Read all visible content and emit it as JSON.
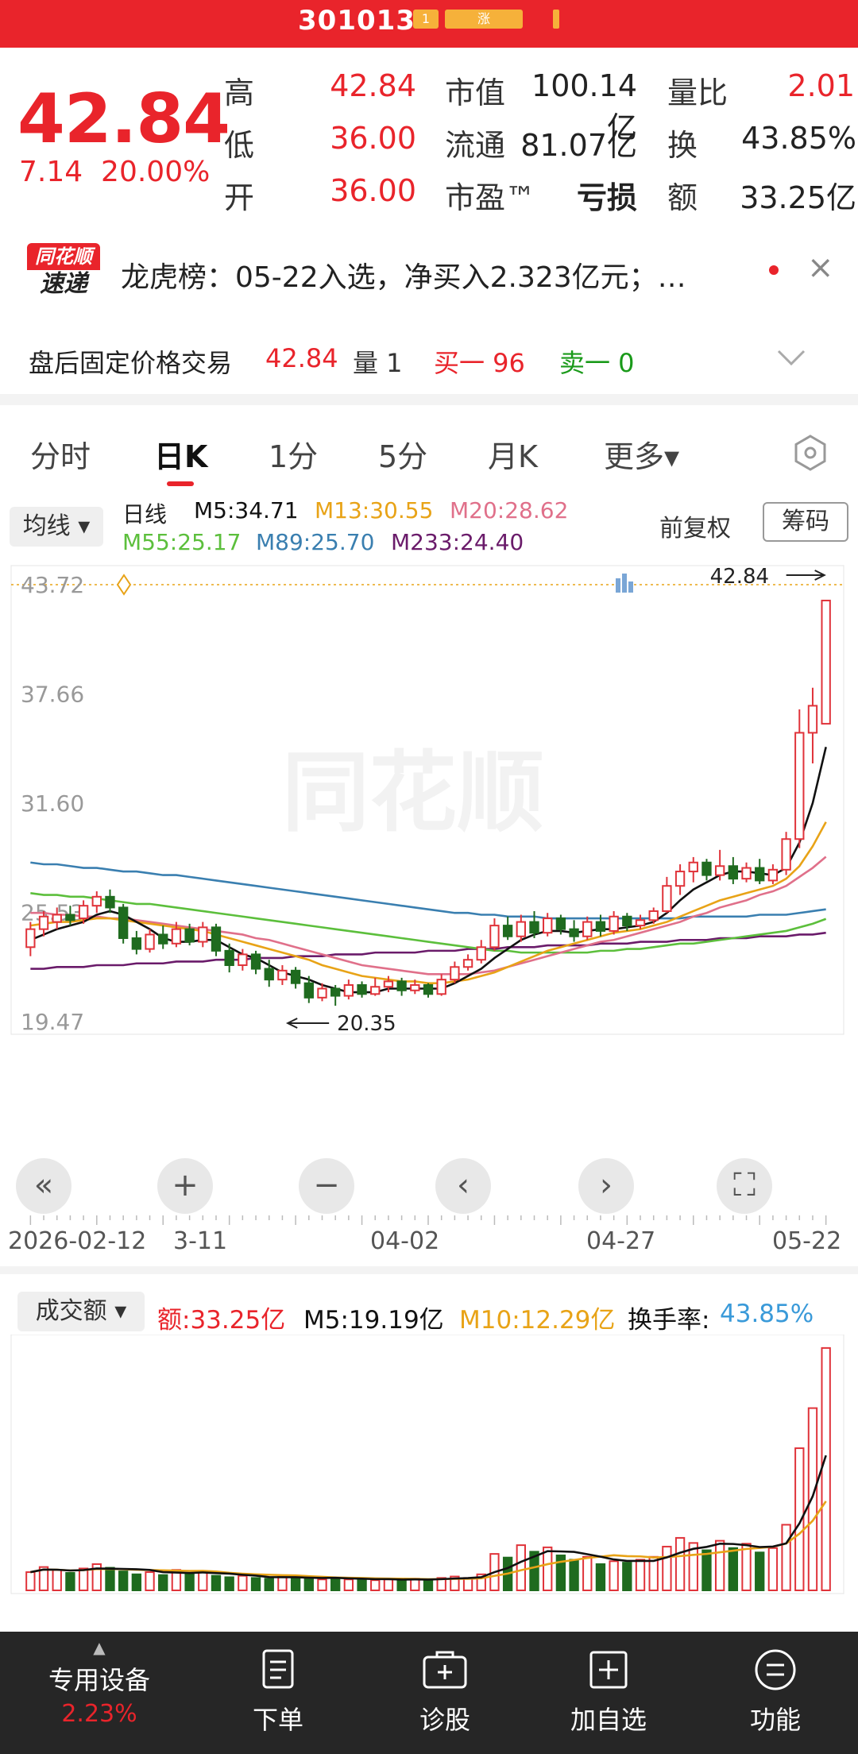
{
  "header": {
    "code": "301013",
    "tag1": "1",
    "tag2": "涨"
  },
  "quote": {
    "price": "42.84",
    "change": "7.14",
    "change_pct": "20.00%",
    "rows": [
      {
        "l1": "高",
        "v1": "42.84",
        "l2": "市值",
        "v2": "100.14亿",
        "l3": "量比",
        "v3": "2.01"
      },
      {
        "l1": "低",
        "v1": "36.00",
        "l2": "流通",
        "v2": "81.07亿",
        "l3": "换",
        "v3": "43.85%"
      },
      {
        "l1": "开",
        "v1": "36.00",
        "l2": "市盈™",
        "v2": "亏损",
        "l3": "额",
        "v3": "33.25亿"
      }
    ]
  },
  "news": {
    "logo_top": "同花顺",
    "logo_bottom": "速递",
    "text": "龙虎榜：05-22入选，净买入2.323亿元；…",
    "close": "×"
  },
  "fixed_trade": {
    "label": "盘后固定价格交易",
    "price": "42.84",
    "vol_label": "量 1",
    "buy": "买一 96",
    "sell": "卖一 0"
  },
  "tabs": [
    "分时",
    "日K",
    "1分",
    "5分",
    "月K",
    "更多▾"
  ],
  "kline_legend": {
    "ma_button": "均线 ▾",
    "daily": "日线",
    "m5": "M5:34.71",
    "m13": "M13:30.55",
    "m20": "M20:28.62",
    "m55": "M55:25.17",
    "m89": "M89:25.70",
    "m233": "M233:24.40",
    "fq": "前复权",
    "chips": "筹码",
    "colors": {
      "m5": "#111111",
      "m13": "#e8a317",
      "m20": "#e0708a",
      "m55": "#5cbf3c",
      "m89": "#3a7fb0",
      "m233": "#6a1b6a"
    }
  },
  "kline_axis": {
    "y_labels": [
      "43.72",
      "37.66",
      "31.60",
      "25.53",
      "19.47"
    ],
    "x_labels": [
      "2026-02-12",
      "3-11",
      "04-02",
      "04-27",
      "05-22"
    ],
    "high_mark": "42.84",
    "low_mark": "20.35"
  },
  "volume_legend": {
    "button": "成交额 ▾",
    "amount": "额:33.25亿",
    "m5": "M5:19.19亿",
    "m10": "M10:12.29亿",
    "turnover_label": "换手率:",
    "turnover": "43.85%"
  },
  "bottom_nav": [
    {
      "label": "专用设备",
      "sub": "2.23%",
      "icon": "▲"
    },
    {
      "label": "下单",
      "icon": "order-icon"
    },
    {
      "label": "诊股",
      "icon": "diagnose-icon"
    },
    {
      "label": "加自选",
      "icon": "add-favorite-icon"
    },
    {
      "label": "功能",
      "icon": "menu-icon"
    }
  ],
  "chart_data": {
    "type": "candlestick",
    "ylim": [
      19.47,
      43.72
    ],
    "candles": [
      [
        23.6,
        24.6,
        23.1,
        25.0
      ],
      [
        24.6,
        25.3,
        24.2,
        25.6
      ],
      [
        25.0,
        25.4,
        24.6,
        25.8
      ],
      [
        25.4,
        25.1,
        24.8,
        25.9
      ],
      [
        25.2,
        25.9,
        24.9,
        26.2
      ],
      [
        25.9,
        26.4,
        25.5,
        26.7
      ],
      [
        26.4,
        25.8,
        25.5,
        26.8
      ],
      [
        25.8,
        24.1,
        23.8,
        26.0
      ],
      [
        24.1,
        23.5,
        23.2,
        24.5
      ],
      [
        23.5,
        24.3,
        23.3,
        24.6
      ],
      [
        24.3,
        23.8,
        23.5,
        24.8
      ],
      [
        23.8,
        24.6,
        23.6,
        25.0
      ],
      [
        24.6,
        23.9,
        23.7,
        24.9
      ],
      [
        23.9,
        24.7,
        23.6,
        25.0
      ],
      [
        24.7,
        23.4,
        23.1,
        24.9
      ],
      [
        23.4,
        22.6,
        22.2,
        23.8
      ],
      [
        22.6,
        23.2,
        22.3,
        23.5
      ],
      [
        23.2,
        22.4,
        22.1,
        23.4
      ],
      [
        22.4,
        21.8,
        21.4,
        22.9
      ],
      [
        21.8,
        22.3,
        21.5,
        22.6
      ],
      [
        22.3,
        21.6,
        21.3,
        22.5
      ],
      [
        21.6,
        20.8,
        20.5,
        22.0
      ],
      [
        20.8,
        21.3,
        20.6,
        21.6
      ],
      [
        21.3,
        20.9,
        20.35,
        21.5
      ],
      [
        20.9,
        21.5,
        20.7,
        21.8
      ],
      [
        21.5,
        21.0,
        20.8,
        21.7
      ],
      [
        21.0,
        21.4,
        20.9,
        21.9
      ],
      [
        21.4,
        21.7,
        21.1,
        22.0
      ],
      [
        21.7,
        21.2,
        20.9,
        21.9
      ],
      [
        21.2,
        21.5,
        21.0,
        21.8
      ],
      [
        21.5,
        21.0,
        20.8,
        21.6
      ],
      [
        21.0,
        21.8,
        20.9,
        22.1
      ],
      [
        21.8,
        22.5,
        21.6,
        22.8
      ],
      [
        22.5,
        22.9,
        22.3,
        23.2
      ],
      [
        22.9,
        23.6,
        22.7,
        24.0
      ],
      [
        23.6,
        24.8,
        23.4,
        25.2
      ],
      [
        24.8,
        24.2,
        24.0,
        25.3
      ],
      [
        24.2,
        25.0,
        23.9,
        25.4
      ],
      [
        25.0,
        24.4,
        24.1,
        25.6
      ],
      [
        24.4,
        25.2,
        24.2,
        25.5
      ],
      [
        25.2,
        24.6,
        24.3,
        25.4
      ],
      [
        24.6,
        24.2,
        23.9,
        25.1
      ],
      [
        24.2,
        25.0,
        24.0,
        25.3
      ],
      [
        25.0,
        24.5,
        24.2,
        25.4
      ],
      [
        24.5,
        25.3,
        24.3,
        25.6
      ],
      [
        25.3,
        24.8,
        24.5,
        25.5
      ],
      [
        24.8,
        25.1,
        24.6,
        25.4
      ],
      [
        25.1,
        25.6,
        24.9,
        25.8
      ],
      [
        25.6,
        27.0,
        25.5,
        27.5
      ],
      [
        27.0,
        27.8,
        26.5,
        28.2
      ],
      [
        27.8,
        28.3,
        27.2,
        28.6
      ],
      [
        28.3,
        27.6,
        27.3,
        28.5
      ],
      [
        27.6,
        28.1,
        27.3,
        29.0
      ],
      [
        28.1,
        27.4,
        27.1,
        28.6
      ],
      [
        27.4,
        28.0,
        27.2,
        28.3
      ],
      [
        28.0,
        27.3,
        27.1,
        28.5
      ],
      [
        27.3,
        27.9,
        27.1,
        28.2
      ],
      [
        27.9,
        29.6,
        27.6,
        30.0
      ],
      [
        29.6,
        35.5,
        29.1,
        36.8
      ],
      [
        35.5,
        37.0,
        33.8,
        38.0
      ],
      [
        36.0,
        42.84,
        36.0,
        42.84
      ]
    ],
    "ma5": [
      24.0,
      24.3,
      24.6,
      24.8,
      25.0,
      25.4,
      25.6,
      25.4,
      25.0,
      24.6,
      24.1,
      23.9,
      23.9,
      24.0,
      24.0,
      23.6,
      23.2,
      23.0,
      22.6,
      22.2,
      22.0,
      21.8,
      21.5,
      21.3,
      21.1,
      21.1,
      21.1,
      21.3,
      21.3,
      21.3,
      21.3,
      21.3,
      21.6,
      22.0,
      22.4,
      23.0,
      23.5,
      24.0,
      24.3,
      24.5,
      24.5,
      24.4,
      24.5,
      24.6,
      24.6,
      24.7,
      24.8,
      25.0,
      25.5,
      26.2,
      26.8,
      27.2,
      27.6,
      27.8,
      27.8,
      27.7,
      27.6,
      28.0,
      29.4,
      31.6,
      34.71
    ],
    "ma13": [
      24.8,
      24.9,
      25.0,
      25.0,
      25.1,
      25.2,
      25.2,
      25.1,
      25.0,
      24.9,
      24.8,
      24.7,
      24.6,
      24.5,
      24.3,
      24.1,
      23.9,
      23.7,
      23.5,
      23.3,
      23.1,
      22.9,
      22.6,
      22.4,
      22.2,
      22.0,
      21.9,
      21.8,
      21.7,
      21.7,
      21.6,
      21.6,
      21.7,
      21.8,
      22.0,
      22.2,
      22.5,
      22.8,
      23.1,
      23.4,
      23.6,
      23.8,
      24.0,
      24.2,
      24.4,
      24.5,
      24.6,
      24.8,
      25.0,
      25.3,
      25.6,
      25.9,
      26.2,
      26.4,
      26.6,
      26.8,
      27.0,
      27.4,
      28.1,
      29.2,
      30.55
    ],
    "ma20": [
      25.5,
      25.5,
      25.4,
      25.4,
      25.3,
      25.3,
      25.2,
      25.2,
      25.1,
      25.0,
      24.9,
      24.8,
      24.7,
      24.6,
      24.5,
      24.4,
      24.3,
      24.1,
      24.0,
      23.8,
      23.6,
      23.4,
      23.2,
      23.0,
      22.8,
      22.6,
      22.5,
      22.4,
      22.3,
      22.2,
      22.1,
      22.1,
      22.1,
      22.1,
      22.2,
      22.3,
      22.5,
      22.7,
      22.9,
      23.1,
      23.3,
      23.5,
      23.7,
      23.9,
      24.0,
      24.2,
      24.4,
      24.6,
      24.8,
      25.0,
      25.3,
      25.5,
      25.8,
      26.0,
      26.2,
      26.5,
      26.7,
      27.0,
      27.5,
      28.0,
      28.62
    ],
    "ma55": [
      26.6,
      26.5,
      26.5,
      26.4,
      26.4,
      26.3,
      26.2,
      26.1,
      26.0,
      26.0,
      25.9,
      25.8,
      25.7,
      25.6,
      25.5,
      25.4,
      25.3,
      25.2,
      25.1,
      25.0,
      24.9,
      24.8,
      24.7,
      24.6,
      24.5,
      24.4,
      24.3,
      24.2,
      24.1,
      24.0,
      23.9,
      23.8,
      23.7,
      23.6,
      23.5,
      23.4,
      23.4,
      23.3,
      23.3,
      23.3,
      23.3,
      23.3,
      23.3,
      23.4,
      23.4,
      23.5,
      23.5,
      23.6,
      23.7,
      23.8,
      23.8,
      23.9,
      24.0,
      24.1,
      24.2,
      24.3,
      24.4,
      24.5,
      24.7,
      24.9,
      25.17
    ],
    "ma89": [
      28.3,
      28.2,
      28.2,
      28.1,
      28.0,
      28.0,
      27.9,
      27.8,
      27.8,
      27.7,
      27.6,
      27.6,
      27.5,
      27.4,
      27.3,
      27.2,
      27.1,
      27.0,
      26.9,
      26.8,
      26.7,
      26.6,
      26.5,
      26.4,
      26.3,
      26.2,
      26.1,
      26.0,
      25.9,
      25.8,
      25.7,
      25.6,
      25.5,
      25.5,
      25.4,
      25.4,
      25.3,
      25.3,
      25.3,
      25.2,
      25.2,
      25.2,
      25.2,
      25.2,
      25.2,
      25.2,
      25.2,
      25.2,
      25.2,
      25.2,
      25.3,
      25.3,
      25.3,
      25.3,
      25.3,
      25.4,
      25.4,
      25.4,
      25.5,
      25.6,
      25.7
    ],
    "ma233": [
      22.4,
      22.4,
      22.5,
      22.5,
      22.5,
      22.6,
      22.6,
      22.6,
      22.7,
      22.7,
      22.7,
      22.8,
      22.8,
      22.8,
      22.9,
      22.9,
      22.9,
      23.0,
      23.0,
      23.0,
      23.1,
      23.1,
      23.1,
      23.2,
      23.2,
      23.2,
      23.3,
      23.3,
      23.3,
      23.3,
      23.4,
      23.4,
      23.4,
      23.5,
      23.5,
      23.5,
      23.6,
      23.6,
      23.6,
      23.7,
      23.7,
      23.7,
      23.7,
      23.8,
      23.8,
      23.8,
      23.9,
      23.9,
      23.9,
      24.0,
      24.0,
      24.0,
      24.1,
      24.1,
      24.1,
      24.2,
      24.2,
      24.2,
      24.3,
      24.3,
      24.4
    ],
    "volume": [
      2.5,
      3.2,
      2.8,
      2.4,
      3.0,
      3.6,
      3.1,
      2.6,
      2.2,
      2.5,
      2.1,
      2.8,
      2.3,
      2.6,
      2.0,
      1.8,
      2.0,
      1.7,
      1.6,
      1.9,
      1.8,
      1.7,
      1.5,
      1.7,
      1.5,
      1.6,
      1.4,
      1.5,
      1.4,
      1.6,
      1.5,
      1.7,
      1.9,
      1.7,
      2.2,
      5.0,
      4.5,
      6.2,
      5.3,
      5.9,
      4.8,
      4.2,
      4.6,
      3.6,
      4.0,
      3.8,
      4.2,
      4.6,
      6.0,
      7.2,
      6.5,
      5.5,
      6.8,
      5.8,
      6.4,
      5.2,
      5.8,
      9.0,
      19.5,
      25.0,
      33.25
    ],
    "volume_ylim": [
      0,
      34
    ]
  }
}
